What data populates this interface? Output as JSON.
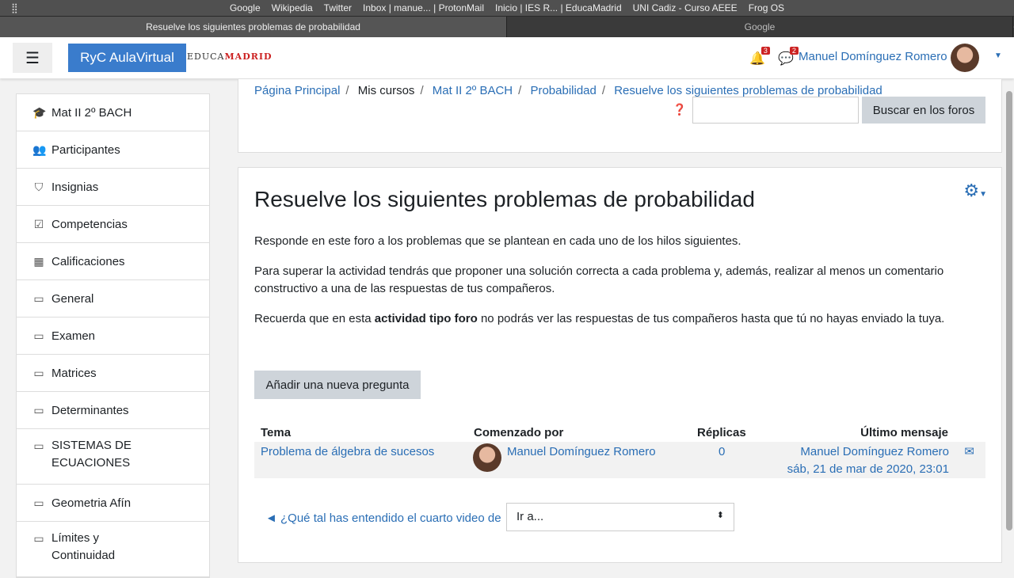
{
  "browser": {
    "bookmarks": [
      "Google",
      "Wikipedia",
      "Twitter",
      "Inbox | manue... | ProtonMail",
      "Inicio | IES R... | EducaMadrid",
      "UNI Cadiz - Curso AEEE",
      "Frog OS"
    ],
    "tabs": [
      "Resuelve los siguientes problemas de probabilidad",
      "Google"
    ],
    "new_tab": "+"
  },
  "navbar": {
    "menu_icon": "☰",
    "brand": "RyC AulaVirtual",
    "logo_prefix": "EDUCA",
    "logo_suffix": "MADRID",
    "notifications": "3",
    "messages": "2",
    "user": "Manuel Domínguez Romero"
  },
  "sidebar": {
    "items": [
      {
        "label": "Mat II 2º BACH",
        "icon": "🎓"
      },
      {
        "label": "Participantes",
        "icon": "👥"
      },
      {
        "label": "Insignias",
        "icon": "⛉"
      },
      {
        "label": "Competencias",
        "icon": "☑"
      },
      {
        "label": "Calificaciones",
        "icon": "▦"
      },
      {
        "label": "General",
        "icon": "▭"
      },
      {
        "label": "Examen",
        "icon": "▭"
      },
      {
        "label": "Matrices",
        "icon": "▭"
      },
      {
        "label": "Determinantes",
        "icon": "▭"
      },
      {
        "label": "SISTEMAS DE ECUACIONES",
        "icon": "▭"
      },
      {
        "label": "Geometria Afín",
        "icon": "▭"
      },
      {
        "label": "Límites y Continuidad",
        "icon": "▭"
      }
    ]
  },
  "breadcrumb": [
    "Página Principal",
    "Mis cursos",
    "Mat II 2º BACH",
    "Probabilidad",
    "Resuelve los siguientes problemas de probabilidad"
  ],
  "search": {
    "button": "Buscar en los foros",
    "value": ""
  },
  "main": {
    "title": "Resuelve los siguientes problemas de probabilidad",
    "p1": "Responde en este foro a los problemas que se plantean en cada uno de los hilos siguientes.",
    "p2": "Para superar la actividad tendrás que proponer una solución correcta a cada problema y, además, realizar al menos un comentario constructivo a una de las respuestas de tus compañeros.",
    "p3_a": "Recuerda que en esta ",
    "p3_b": "actividad tipo foro",
    "p3_c": " no podrás ver las respuestas de tus compañeros hasta que tú no hayas enviado la tuya.",
    "add_button": "Añadir una nueva pregunta",
    "table": {
      "headers": [
        "Tema",
        "Comenzado por",
        "Réplicas",
        "Último mensaje"
      ],
      "rows": [
        {
          "topic": "Problema de álgebra de sucesos",
          "author": "Manuel Domínguez Romero",
          "replies": "0",
          "last_author": "Manuel Domínguez Romero",
          "last_date": "sáb, 21 de mar de 2020, 23:01"
        }
      ]
    },
    "prev_link": "◄ ¿Qué tal has entendido el cuarto video de",
    "jump_select": "Ir a..."
  }
}
